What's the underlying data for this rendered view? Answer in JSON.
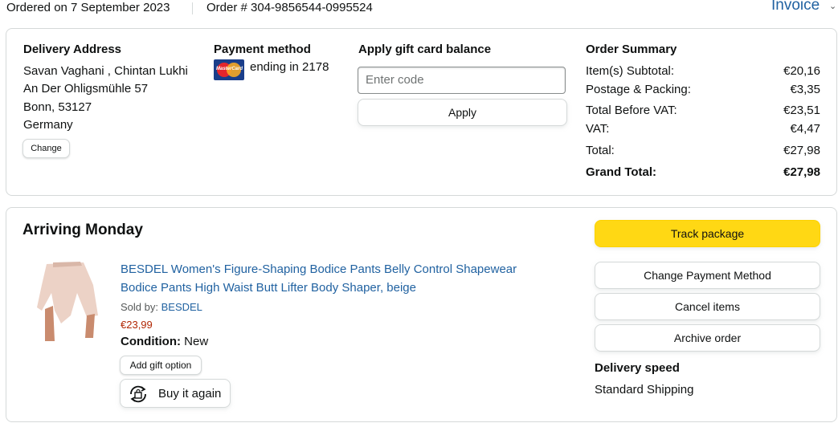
{
  "header": {
    "ordered_on": "Ordered on 7 September 2023",
    "order_number": "Order # 304-9856544-0995524",
    "invoice_label": "Invoice",
    "invoice_chevron": "⌄"
  },
  "delivery_address": {
    "title": "Delivery Address",
    "lines": [
      "Savan Vaghani , Chintan Lukhi",
      "An Der Ohligsmühle 57",
      "Bonn, 53127",
      "Germany"
    ],
    "change_label": "Change"
  },
  "payment": {
    "title": "Payment method",
    "card_icon": "mastercard-icon",
    "card_text": "ending in 2178"
  },
  "gift_card": {
    "title": "Apply gift card balance",
    "placeholder": "Enter code",
    "apply_label": "Apply"
  },
  "order_summary": {
    "title": "Order Summary",
    "rows": [
      {
        "label": "Item(s) Subtotal:",
        "value": "€20,16"
      },
      {
        "label": "Postage & Packing:",
        "value": "€3,35"
      },
      {
        "label": "Total Before VAT:",
        "value": "€23,51"
      },
      {
        "label": "VAT:",
        "value": "€4,47"
      },
      {
        "label": "Total:",
        "value": "€27,98"
      },
      {
        "label": "Grand Total:",
        "value": "€27,98"
      }
    ]
  },
  "shipment": {
    "status": "Arriving Monday",
    "product": {
      "title_line1": "BESDEL Women's Figure-Shaping Bodice Pants Belly Control Shapewear",
      "title_line2": "Bodice Pants High Waist Butt Lifter Body Shaper, beige",
      "sold_by_label": "Sold by:",
      "seller": "BESDEL",
      "price": "€23,99",
      "condition_label": "Condition:",
      "condition_value": "New",
      "gift_option_label": "Add gift option",
      "buy_again_label": "Buy it again",
      "buy_again_icon": "repeat-bag-icon"
    },
    "actions": {
      "track": "Track package",
      "change_payment": "Change Payment Method",
      "cancel": "Cancel items",
      "archive": "Archive order"
    },
    "delivery_speed_title": "Delivery speed",
    "delivery_speed_value": "Standard Shipping"
  },
  "colors": {
    "link": "#2162a1",
    "price": "#b12704",
    "primary_button": "#ffd814",
    "border": "#d5d9d9"
  }
}
